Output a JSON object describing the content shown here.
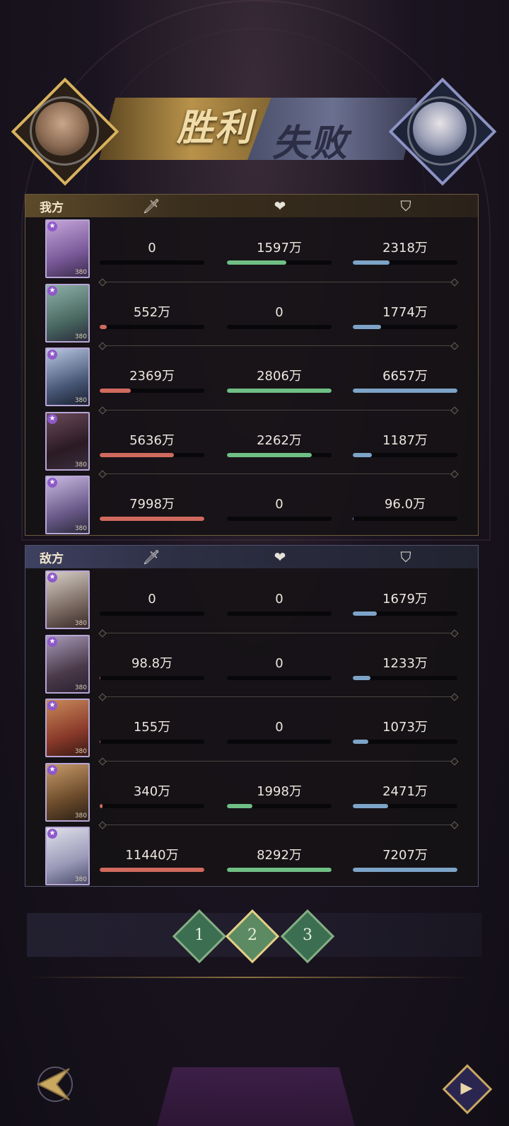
{
  "banner": {
    "win_text": "胜利",
    "lose_text": "失败"
  },
  "colors": {
    "attack_bar": "#d06a5e",
    "heal_bar": "#6fbf85",
    "defense_bar": "#7da4c8",
    "ally_accent": "#b8924a",
    "enemy_accent": "#6b7090"
  },
  "ally": {
    "label": "我方",
    "rows": [
      {
        "level": "380",
        "atk": "0",
        "heal": "1597万",
        "def": "2318万",
        "atk_pct": 0,
        "heal_pct": 57,
        "def_pct": 35
      },
      {
        "level": "380",
        "atk": "552万",
        "heal": "0",
        "def": "1774万",
        "atk_pct": 7,
        "heal_pct": 0,
        "def_pct": 27
      },
      {
        "level": "380",
        "atk": "2369万",
        "heal": "2806万",
        "def": "6657万",
        "atk_pct": 30,
        "heal_pct": 100,
        "def_pct": 100
      },
      {
        "level": "380",
        "atk": "5636万",
        "heal": "2262万",
        "def": "1187万",
        "atk_pct": 71,
        "heal_pct": 81,
        "def_pct": 18
      },
      {
        "level": "380",
        "atk": "7998万",
        "heal": "0",
        "def": "96.0万",
        "atk_pct": 100,
        "heal_pct": 0,
        "def_pct": 1
      }
    ]
  },
  "enemy": {
    "label": "敌方",
    "rows": [
      {
        "level": "380",
        "atk": "0",
        "heal": "0",
        "def": "1679万",
        "atk_pct": 0,
        "heal_pct": 0,
        "def_pct": 23
      },
      {
        "level": "380",
        "atk": "98.8万",
        "heal": "0",
        "def": "1233万",
        "atk_pct": 1,
        "heal_pct": 0,
        "def_pct": 17
      },
      {
        "level": "380",
        "atk": "155万",
        "heal": "0",
        "def": "1073万",
        "atk_pct": 1,
        "heal_pct": 0,
        "def_pct": 15
      },
      {
        "level": "380",
        "atk": "340万",
        "heal": "1998万",
        "def": "2471万",
        "atk_pct": 3,
        "heal_pct": 24,
        "def_pct": 34
      },
      {
        "level": "380",
        "atk": "11440万",
        "heal": "8292万",
        "def": "7207万",
        "atk_pct": 100,
        "heal_pct": 100,
        "def_pct": 100
      }
    ]
  },
  "rounds": {
    "items": [
      "1",
      "2",
      "3"
    ],
    "selected": "2"
  },
  "icons": {
    "attack": "sword-icon",
    "heal": "heart-icon",
    "defense": "shield-icon",
    "back": "back-arrow-icon",
    "replay": "replay-icon"
  }
}
